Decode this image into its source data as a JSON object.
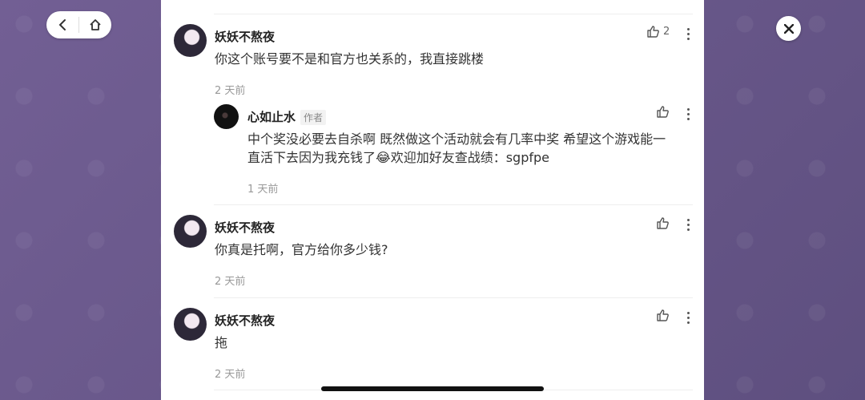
{
  "comments": [
    {
      "user": "妖妖不熬夜",
      "text": "你这个账号要不是和官方也关系的，我直接跳楼",
      "time": "2 天前",
      "likes": "2"
    },
    {
      "user": "心如止水",
      "badge": "作者",
      "text_line1": "中个奖没必要去自杀啊 既然做这个活动就会有几率中奖 希望这个游戏能一",
      "text_line2": "直活下去因为我充钱了😂欢迎加好友查战绩：sgpfpe",
      "time": "1 天前"
    },
    {
      "user": "妖妖不熬夜",
      "text": "你真是托啊，官方给你多少钱?",
      "time": "2 天前"
    },
    {
      "user": "妖妖不熬夜",
      "text": "拖",
      "time": "2 天前"
    }
  ],
  "icons": {
    "back": "chevron-left-icon",
    "home": "home-icon",
    "close": "close-icon",
    "like": "thumbs-up-icon",
    "more": "more-vertical-icon"
  }
}
